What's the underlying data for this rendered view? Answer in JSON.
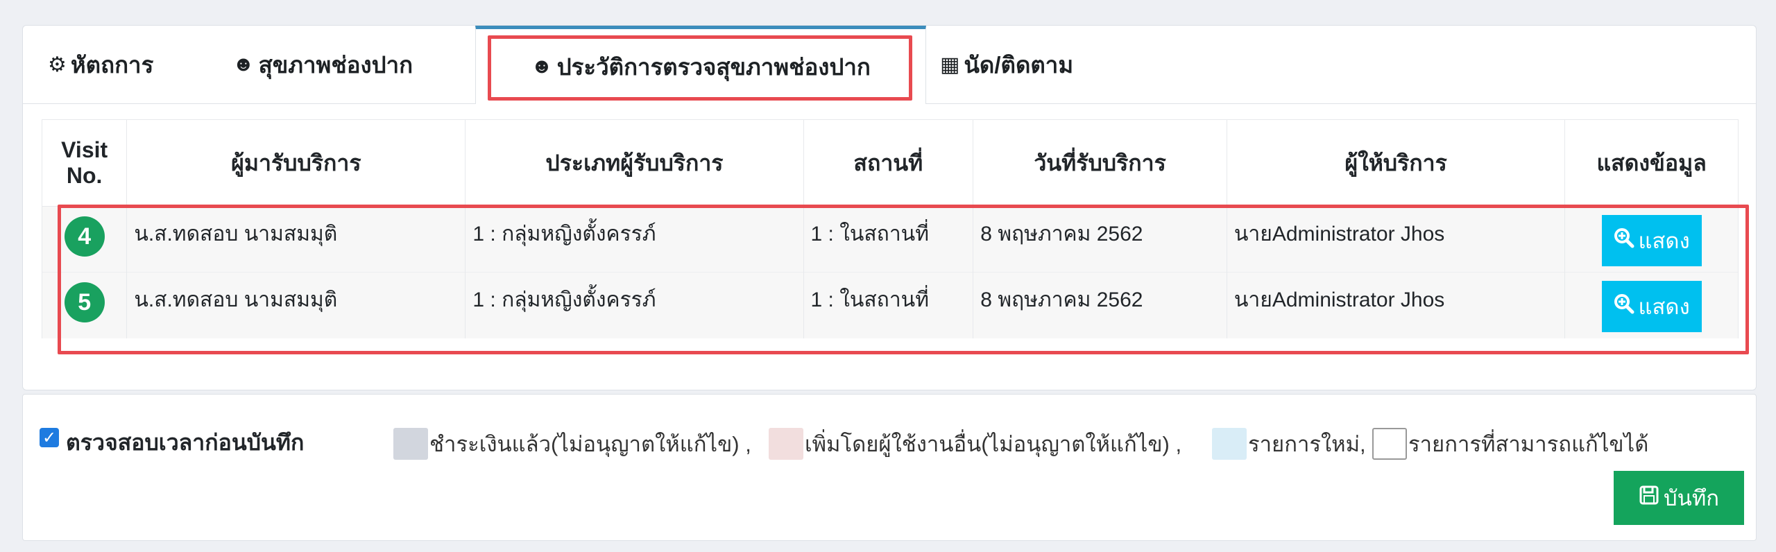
{
  "tabs": [
    {
      "icon": "procedure-icon",
      "glyph": "⚙",
      "label": "หัตถการ"
    },
    {
      "icon": "tooth-icon",
      "glyph": "☻",
      "label": "สุขภาพช่องปาก"
    },
    {
      "icon": "tooth-icon",
      "glyph": "☻",
      "label": "ประวัติการตรวจสุขภาพช่องปาก"
    },
    {
      "icon": "calendar-icon",
      "glyph": "▦",
      "label": "นัด/ติดตาม"
    }
  ],
  "table": {
    "headers": {
      "visit": "Visit",
      "visit2": "No.",
      "patient": "ผู้มารับบริการ",
      "type": "ประเภทผู้รับบริการ",
      "place": "สถานที่",
      "date": "วันที่รับบริการ",
      "provider": "ผู้ให้บริการ",
      "show": "แสดงข้อมูล"
    },
    "rows": [
      {
        "visit": "4",
        "patient": "น.ส.ทดสอบ นามสมมุติ",
        "type": "1 : กลุ่มหญิงตั้งครรภ์",
        "place": "1 : ในสถานที่",
        "date": "8 พฤษภาคม 2562",
        "provider": "นายAdministrator Jhos",
        "button": "แสดง"
      },
      {
        "visit": "5",
        "patient": "น.ส.ทดสอบ นามสมมุติ",
        "type": "1 : กลุ่มหญิงตั้งครรภ์",
        "place": "1 : ในสถานที่",
        "date": "8 พฤษภาคม 2562",
        "provider": "นายAdministrator Jhos",
        "button": "แสดง"
      }
    ]
  },
  "footer": {
    "check_label": "ตรวจสอบเวลาก่อนบันทึก",
    "legend": [
      {
        "label": "ชำระเงินแล้ว(ไม่อนุญาตให้แก้ไข) ,",
        "color": "#d2d6de"
      },
      {
        "label": "เพิ่มโดยผู้ใช้งานอื่น(ไม่อนุญาตให้แก้ไข) ,",
        "color": "#f2dede"
      },
      {
        "label": "รายการใหม่,",
        "color": "#d9edf7"
      },
      {
        "label": "รายการที่สามารถแก้ไขได้",
        "color": "#ffffff"
      }
    ],
    "save_label": "บันทึก"
  },
  "colors": {
    "accent": "#3c8dbc",
    "highlight": "#e84a50",
    "badge": "#19a15f",
    "info": "#00c0ef",
    "save": "#14a45c"
  }
}
